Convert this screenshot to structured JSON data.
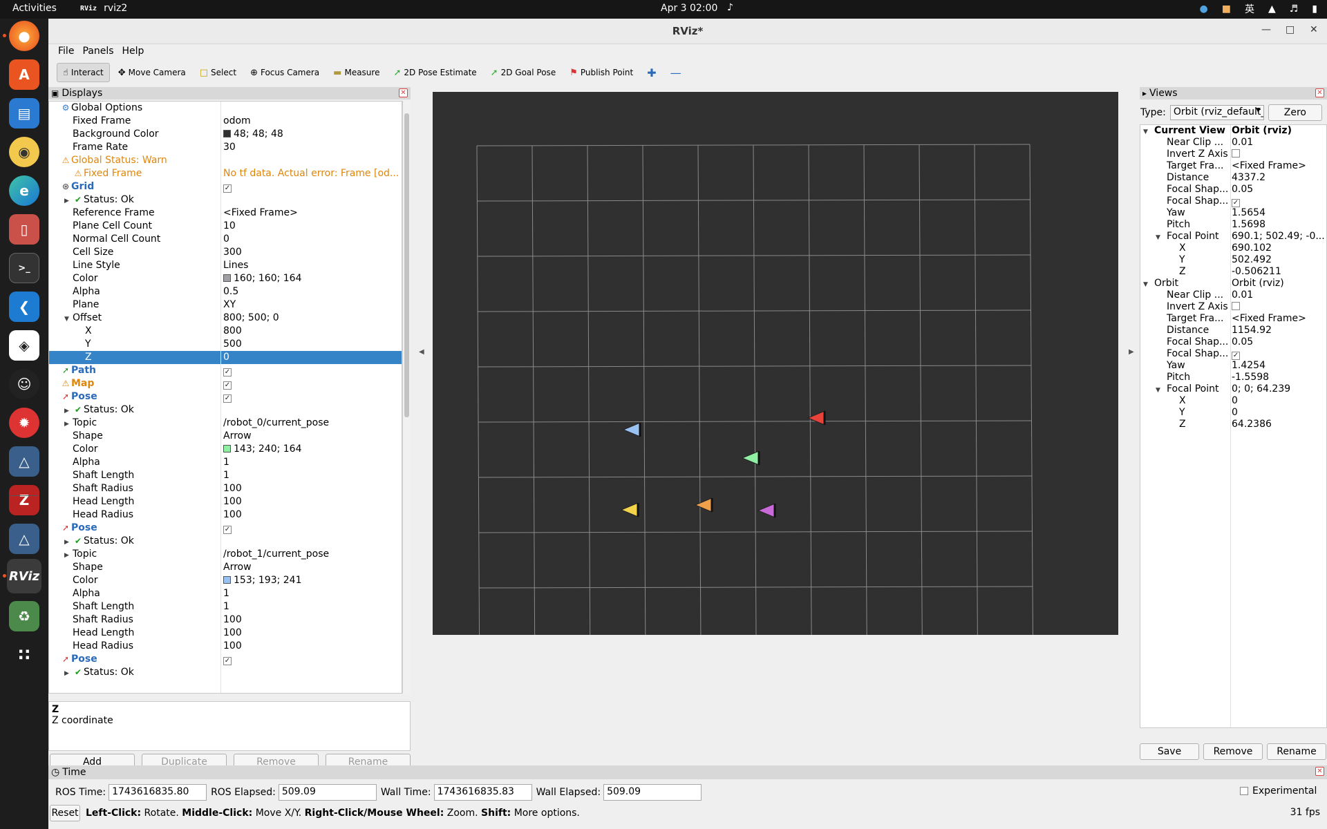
{
  "topbar": {
    "activities": "Activities",
    "app_name": "rviz2",
    "app_icon_text": "RViz",
    "clock": "Apr 3  02:00",
    "lang": "英"
  },
  "dock": {
    "items": [
      "firefox-icon",
      "app-center-icon",
      "writer-icon",
      "rhythmbox-icon",
      "edge-icon",
      "files-icon",
      "terminal-icon",
      "vscode-icon",
      "unity-icon",
      "qq-icon",
      "ladybug-icon",
      "cat-icon",
      "zotero-icon",
      "cat-app-icon",
      "rviz-icon",
      "trash-icon",
      "app-grid-icon"
    ]
  },
  "window": {
    "title": "RViz*",
    "menu": [
      "File",
      "Panels",
      "Help"
    ]
  },
  "toolbar": {
    "interact": "Interact",
    "move_camera": "Move Camera",
    "select": "Select",
    "focus_camera": "Focus Camera",
    "measure": "Measure",
    "pose_estimate": "2D Pose Estimate",
    "goal_pose": "2D Goal Pose",
    "publish_point": "Publish Point"
  },
  "displays": {
    "title": "Displays",
    "rows": [
      {
        "name": "Global Options",
        "value": "",
        "indent": 0,
        "style": "normal",
        "icon": "gear"
      },
      {
        "name": "Fixed Frame",
        "value": "odom",
        "indent": 1
      },
      {
        "name": "Background Color",
        "value": "48; 48; 48",
        "indent": 1,
        "swatch": "#303030"
      },
      {
        "name": "Frame Rate",
        "value": "30",
        "indent": 1
      },
      {
        "name": "Global Status: Warn",
        "value": "",
        "indent": 0,
        "style": "orange",
        "icon": "warn"
      },
      {
        "name": "Fixed Frame",
        "value": "No tf data.  Actual error: Frame [od...",
        "indent": 1,
        "style": "orange",
        "icon": "warn"
      },
      {
        "name": "Grid",
        "value": "",
        "indent": 0,
        "style": "blue",
        "icon": "grid",
        "check": true
      },
      {
        "name": "Status: Ok",
        "value": "",
        "indent": 1,
        "arrow": "right",
        "icon": "ok"
      },
      {
        "name": "Reference Frame",
        "value": "<Fixed Frame>",
        "indent": 1
      },
      {
        "name": "Plane Cell Count",
        "value": "10",
        "indent": 1
      },
      {
        "name": "Normal Cell Count",
        "value": "0",
        "indent": 1
      },
      {
        "name": "Cell Size",
        "value": "300",
        "indent": 1
      },
      {
        "name": "Line Style",
        "value": "Lines",
        "indent": 1
      },
      {
        "name": "Color",
        "value": "160; 160; 164",
        "indent": 1,
        "swatch": "#a0a0a4"
      },
      {
        "name": "Alpha",
        "value": "0.5",
        "indent": 1
      },
      {
        "name": "Plane",
        "value": "XY",
        "indent": 1
      },
      {
        "name": "Offset",
        "value": "800; 500; 0",
        "indent": 1,
        "arrow": "down"
      },
      {
        "name": "X",
        "value": "800",
        "indent": 2
      },
      {
        "name": "Y",
        "value": "500",
        "indent": 2
      },
      {
        "name": "Z",
        "value": "0",
        "indent": 2,
        "selected": true
      },
      {
        "name": "Path",
        "value": "",
        "indent": 0,
        "style": "blue",
        "icon": "path",
        "check": true
      },
      {
        "name": "Map",
        "value": "",
        "indent": 0,
        "style": "orangeb",
        "icon": "warn",
        "check": true
      },
      {
        "name": "Pose",
        "value": "",
        "indent": 0,
        "style": "blue",
        "icon": "pose",
        "check": true
      },
      {
        "name": "Status: Ok",
        "value": "",
        "indent": 1,
        "arrow": "right",
        "icon": "ok"
      },
      {
        "name": "Topic",
        "value": "/robot_0/current_pose",
        "indent": 1,
        "arrow": "right"
      },
      {
        "name": "Shape",
        "value": "Arrow",
        "indent": 1
      },
      {
        "name": "Color",
        "value": "143; 240; 164",
        "indent": 1,
        "swatch": "#8ff0a4"
      },
      {
        "name": "Alpha",
        "value": "1",
        "indent": 1
      },
      {
        "name": "Shaft Length",
        "value": "1",
        "indent": 1
      },
      {
        "name": "Shaft Radius",
        "value": "100",
        "indent": 1
      },
      {
        "name": "Head Length",
        "value": "100",
        "indent": 1
      },
      {
        "name": "Head Radius",
        "value": "100",
        "indent": 1
      },
      {
        "name": "Pose",
        "value": "",
        "indent": 0,
        "style": "blue",
        "icon": "pose",
        "check": true
      },
      {
        "name": "Status: Ok",
        "value": "",
        "indent": 1,
        "arrow": "right",
        "icon": "ok"
      },
      {
        "name": "Topic",
        "value": "/robot_1/current_pose",
        "indent": 1,
        "arrow": "right"
      },
      {
        "name": "Shape",
        "value": "Arrow",
        "indent": 1
      },
      {
        "name": "Color",
        "value": "153; 193; 241",
        "indent": 1,
        "swatch": "#99c1f1"
      },
      {
        "name": "Alpha",
        "value": "1",
        "indent": 1
      },
      {
        "name": "Shaft Length",
        "value": "1",
        "indent": 1
      },
      {
        "name": "Shaft Radius",
        "value": "100",
        "indent": 1
      },
      {
        "name": "Head Length",
        "value": "100",
        "indent": 1
      },
      {
        "name": "Head Radius",
        "value": "100",
        "indent": 1
      },
      {
        "name": "Pose",
        "value": "",
        "indent": 0,
        "style": "blue",
        "icon": "pose",
        "check": true
      },
      {
        "name": "Status: Ok",
        "value": "",
        "indent": 1,
        "arrow": "right",
        "icon": "ok"
      }
    ],
    "desc_title": "Z",
    "desc_text": "Z coordinate",
    "buttons": {
      "add": "Add",
      "duplicate": "Duplicate",
      "remove": "Remove",
      "rename": "Rename"
    }
  },
  "viewport": {
    "background": "#303030",
    "grid_color": "#8a8a8a",
    "arrows": [
      {
        "color": "#99c1f1",
        "label": "robot-arrow-blue"
      },
      {
        "color": "#e8433a",
        "label": "robot-arrow-red"
      },
      {
        "color": "#8ff0a4",
        "label": "robot-arrow-green"
      },
      {
        "color": "#f2d14b",
        "label": "robot-arrow-yellow"
      },
      {
        "color": "#f0a04b",
        "label": "robot-arrow-orange"
      },
      {
        "color": "#c86ad8",
        "label": "robot-arrow-purple"
      }
    ]
  },
  "views": {
    "title": "Views",
    "type_label": "Type:",
    "type_value": "Orbit (rviz_default_plugins)",
    "zero": "Zero",
    "rows": [
      {
        "name": "Current View",
        "value": "Orbit (rviz)",
        "indent": 0,
        "arrow": "down",
        "bold": true
      },
      {
        "name": "Near Clip ...",
        "value": "0.01",
        "indent": 1
      },
      {
        "name": "Invert Z Axis",
        "value": "",
        "indent": 1,
        "check": false
      },
      {
        "name": "Target Fra...",
        "value": "<Fixed Frame>",
        "indent": 1
      },
      {
        "name": "Distance",
        "value": "4337.2",
        "indent": 1
      },
      {
        "name": "Focal Shap...",
        "value": "0.05",
        "indent": 1
      },
      {
        "name": "Focal Shap...",
        "value": "",
        "indent": 1,
        "check": true
      },
      {
        "name": "Yaw",
        "value": "1.5654",
        "indent": 1
      },
      {
        "name": "Pitch",
        "value": "1.5698",
        "indent": 1
      },
      {
        "name": "Focal Point",
        "value": "690.1; 502.49; -0...",
        "indent": 1,
        "arrow": "down"
      },
      {
        "name": "X",
        "value": "690.102",
        "indent": 2
      },
      {
        "name": "Y",
        "value": "502.492",
        "indent": 2
      },
      {
        "name": "Z",
        "value": "-0.506211",
        "indent": 2
      },
      {
        "name": "Orbit",
        "value": "Orbit (rviz)",
        "indent": 0,
        "arrow": "down"
      },
      {
        "name": "Near Clip ...",
        "value": "0.01",
        "indent": 1
      },
      {
        "name": "Invert Z Axis",
        "value": "",
        "indent": 1,
        "check": false
      },
      {
        "name": "Target Fra...",
        "value": "<Fixed Frame>",
        "indent": 1
      },
      {
        "name": "Distance",
        "value": "1154.92",
        "indent": 1
      },
      {
        "name": "Focal Shap...",
        "value": "0.05",
        "indent": 1
      },
      {
        "name": "Focal Shap...",
        "value": "",
        "indent": 1,
        "check": true
      },
      {
        "name": "Yaw",
        "value": "1.4254",
        "indent": 1
      },
      {
        "name": "Pitch",
        "value": "-1.5598",
        "indent": 1
      },
      {
        "name": "Focal Point",
        "value": "0; 0; 64.239",
        "indent": 1,
        "arrow": "down"
      },
      {
        "name": "X",
        "value": "0",
        "indent": 2
      },
      {
        "name": "Y",
        "value": "0",
        "indent": 2
      },
      {
        "name": "Z",
        "value": "64.2386",
        "indent": 2
      }
    ],
    "buttons": {
      "save": "Save",
      "remove": "Remove",
      "rename": "Rename"
    }
  },
  "time": {
    "title": "Time",
    "ros_time_label": "ROS Time:",
    "ros_time": "1743616835.80",
    "ros_elapsed_label": "ROS Elapsed:",
    "ros_elapsed": "509.09",
    "wall_time_label": "Wall Time:",
    "wall_time": "1743616835.83",
    "wall_elapsed_label": "Wall Elapsed:",
    "wall_elapsed": "509.09",
    "experimental": "Experimental",
    "reset": "Reset",
    "help_parts": [
      "Left-Click:",
      " Rotate. ",
      "Middle-Click:",
      " Move X/Y. ",
      "Right-Click/Mouse Wheel:",
      " Zoom. ",
      "Shift:",
      " More options."
    ],
    "fps": "31 fps"
  }
}
